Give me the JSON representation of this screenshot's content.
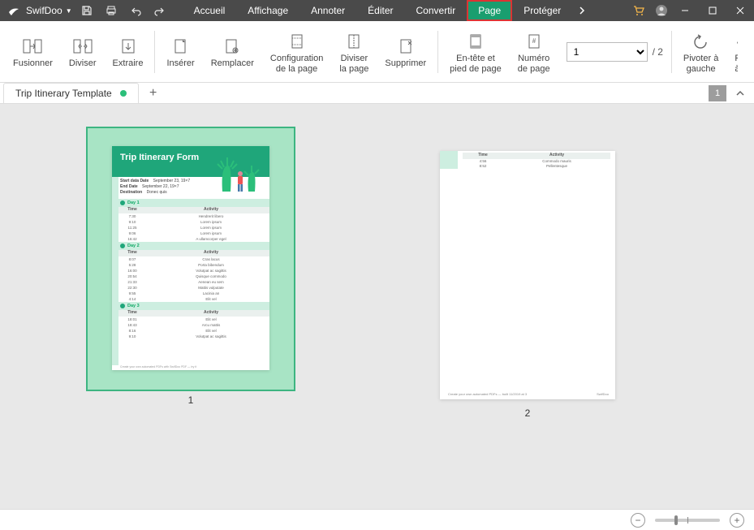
{
  "app": {
    "name": "SwifDoo"
  },
  "qat_icons": [
    "save-icon",
    "print-icon",
    "undo-icon",
    "redo-icon"
  ],
  "menu": [
    {
      "label": "Accueil"
    },
    {
      "label": "Affichage"
    },
    {
      "label": "Annoter"
    },
    {
      "label": "Éditer"
    },
    {
      "label": "Convertir"
    },
    {
      "label": "Page",
      "active": true
    },
    {
      "label": "Protéger"
    }
  ],
  "ribbon": {
    "groups": [
      {
        "label": "Fusionner",
        "icon": "merge-icon"
      },
      {
        "label": "Diviser",
        "icon": "split-icon"
      },
      {
        "label": "Extraire",
        "icon": "extract-icon"
      },
      {
        "sep": true
      },
      {
        "label": "Insérer",
        "icon": "insert-icon"
      },
      {
        "label": "Remplacer",
        "icon": "replace-icon"
      },
      {
        "label": "Configuration\nde la page",
        "icon": "page-setup-icon"
      },
      {
        "label": "Diviser\nla page",
        "icon": "split-page-icon"
      },
      {
        "label": "Supprimer",
        "icon": "delete-icon"
      },
      {
        "sep": true
      },
      {
        "label": "En-tête et\npied de page",
        "icon": "header-footer-icon"
      },
      {
        "label": "Numéro\nde page",
        "icon": "page-number-icon"
      }
    ],
    "page_select_value": "1",
    "page_total": "/ 2",
    "rotate": {
      "label": "Pivoter à\ngauche",
      "icon": "rotate-left-icon"
    },
    "rotate_right_hint": "à"
  },
  "tab": {
    "title": "Trip Itinerary Template"
  },
  "page_indicator": "1",
  "thumbs": [
    {
      "num": "1",
      "selected": true
    },
    {
      "num": "2",
      "selected": false
    }
  ],
  "page1": {
    "title": "Trip Itinerary Form",
    "meta": [
      {
        "k": "Start data Date",
        "v": "September 23, 19×7"
      },
      {
        "k": "End Date",
        "v": "September 22, 19×7"
      },
      {
        "k": "Destination",
        "v": "Donec quis"
      }
    ],
    "thead": {
      "c1": "Time",
      "c2": "Activity"
    },
    "days": [
      {
        "name": "Day 1",
        "rows": [
          {
            "t": "7:30",
            "a": "Hendrerit libero"
          },
          {
            "t": "9:10",
            "a": "Lorem ipsum"
          },
          {
            "t": "11:25",
            "a": "Lorem ipsum"
          },
          {
            "t": "9:06",
            "a": "Lorem ipsum"
          },
          {
            "t": "16:42",
            "a": "A ullamcorper egel"
          }
        ]
      },
      {
        "name": "Day 2",
        "rows": [
          {
            "t": "8:07",
            "a": "Cras lacus"
          },
          {
            "t": "5:28",
            "a": "Porta bibendum"
          },
          {
            "t": "16:00",
            "a": "Volutpat ac sagittis"
          },
          {
            "t": "20:54",
            "a": "Quisque commodo"
          },
          {
            "t": "21:33",
            "a": "Aenean eu sem"
          },
          {
            "t": "22:30",
            "a": "Mattis vulputate"
          },
          {
            "t": "9:55",
            "a": "Lacinia an"
          },
          {
            "t": "4:14",
            "a": "Elit vel"
          }
        ]
      },
      {
        "name": "Day 3",
        "rows": [
          {
            "t": "18:01",
            "a": "Elit vel"
          },
          {
            "t": "18:43",
            "a": "Arcu mattis"
          },
          {
            "t": "8:16",
            "a": "Elit vel"
          },
          {
            "t": "9:10",
            "a": "Volutpat ac sagittis"
          }
        ]
      }
    ],
    "footer": "Create your own automated PDFs with SwifDoo PDF — try it"
  },
  "page2": {
    "thead": {
      "c1": "Time",
      "c2": "Activity"
    },
    "rows": [
      {
        "t": "4:56",
        "a": "Commodo mauris"
      },
      {
        "t": "8:52",
        "a": "Pellentesque"
      }
    ],
    "footer_left": "Create your own automated PDFs — built 11/2019 at 3",
    "footer_right": "SwifDoo"
  }
}
